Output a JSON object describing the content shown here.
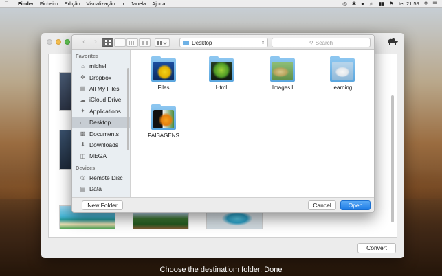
{
  "menubar": {
    "items": [
      "Finder",
      "Ficheiro",
      "Edição",
      "Visualização",
      "Ir",
      "Janela",
      "Ajuda"
    ],
    "clock": "ter 21:59"
  },
  "dialog": {
    "location": "Desktop",
    "search_placeholder": "Search",
    "sidebar": {
      "favorites_heading": "Favorites",
      "favorites": [
        {
          "label": "michel",
          "icon": "home-icon"
        },
        {
          "label": "Dropbox",
          "icon": "dropbox-icon"
        },
        {
          "label": "All My Files",
          "icon": "all-files-icon"
        },
        {
          "label": "iCloud Drive",
          "icon": "cloud-icon"
        },
        {
          "label": "Applications",
          "icon": "applications-icon"
        },
        {
          "label": "Desktop",
          "icon": "desktop-icon",
          "selected": true
        },
        {
          "label": "Documents",
          "icon": "documents-icon"
        },
        {
          "label": "Downloads",
          "icon": "downloads-icon"
        },
        {
          "label": "MEGA",
          "icon": "folder-icon"
        }
      ],
      "devices_heading": "Devices",
      "devices": [
        {
          "label": "Remote Disc",
          "icon": "disc-icon"
        },
        {
          "label": "Data",
          "icon": "disk-icon"
        }
      ]
    },
    "files": [
      {
        "name": "Files"
      },
      {
        "name": "Html"
      },
      {
        "name": "Images.l"
      },
      {
        "name": "learning"
      },
      {
        "name": "PAISAGENS"
      }
    ],
    "buttons": {
      "new_folder": "New Folder",
      "cancel": "Cancel",
      "open": "Open"
    }
  },
  "app": {
    "convert_label": "Convert"
  },
  "caption": "Choose the destinatiom folder. Done",
  "colors": {
    "accent": "#1f7de6",
    "selection": "#c7cdd3"
  }
}
